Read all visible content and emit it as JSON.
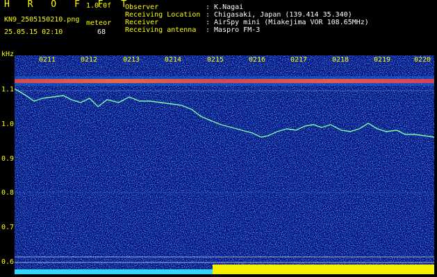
{
  "header": {
    "app_title": "H R O F F T",
    "version": "1.0.0f",
    "filename": "KN9_2505150210.png",
    "datetime": "25.05.15 02:10",
    "meteor_label": "meteor",
    "meteor_count": "68",
    "observer_label": "Observer",
    "observer_value": ": K.Nagai",
    "location_label": "Receiving Location",
    "location_value": ": Chigasaki, Japan (139.414 35.340)",
    "receiver_label": "Receiver",
    "receiver_value": ": AirSpy mini (Miakejima VOR 108.65MHz)",
    "antenna_label": "Receiving antenna",
    "antenna_value": ": Maspro FM-3"
  },
  "axis": {
    "unit": "kHz",
    "y_ticks": [
      "1.1",
      "1.0",
      "0.9",
      "0.8",
      "0.7",
      "0.6"
    ],
    "x_ticks": [
      "0211",
      "0212",
      "0213",
      "0214",
      "0215",
      "0216",
      "0217",
      "0218",
      "0219",
      "0220"
    ]
  },
  "colors": {
    "background": "#000000",
    "plot_bg": "#00087a",
    "label": "#ffff00",
    "text": "#ffffff",
    "trace": "#7dffb0",
    "carrier": "#ff4040"
  }
}
